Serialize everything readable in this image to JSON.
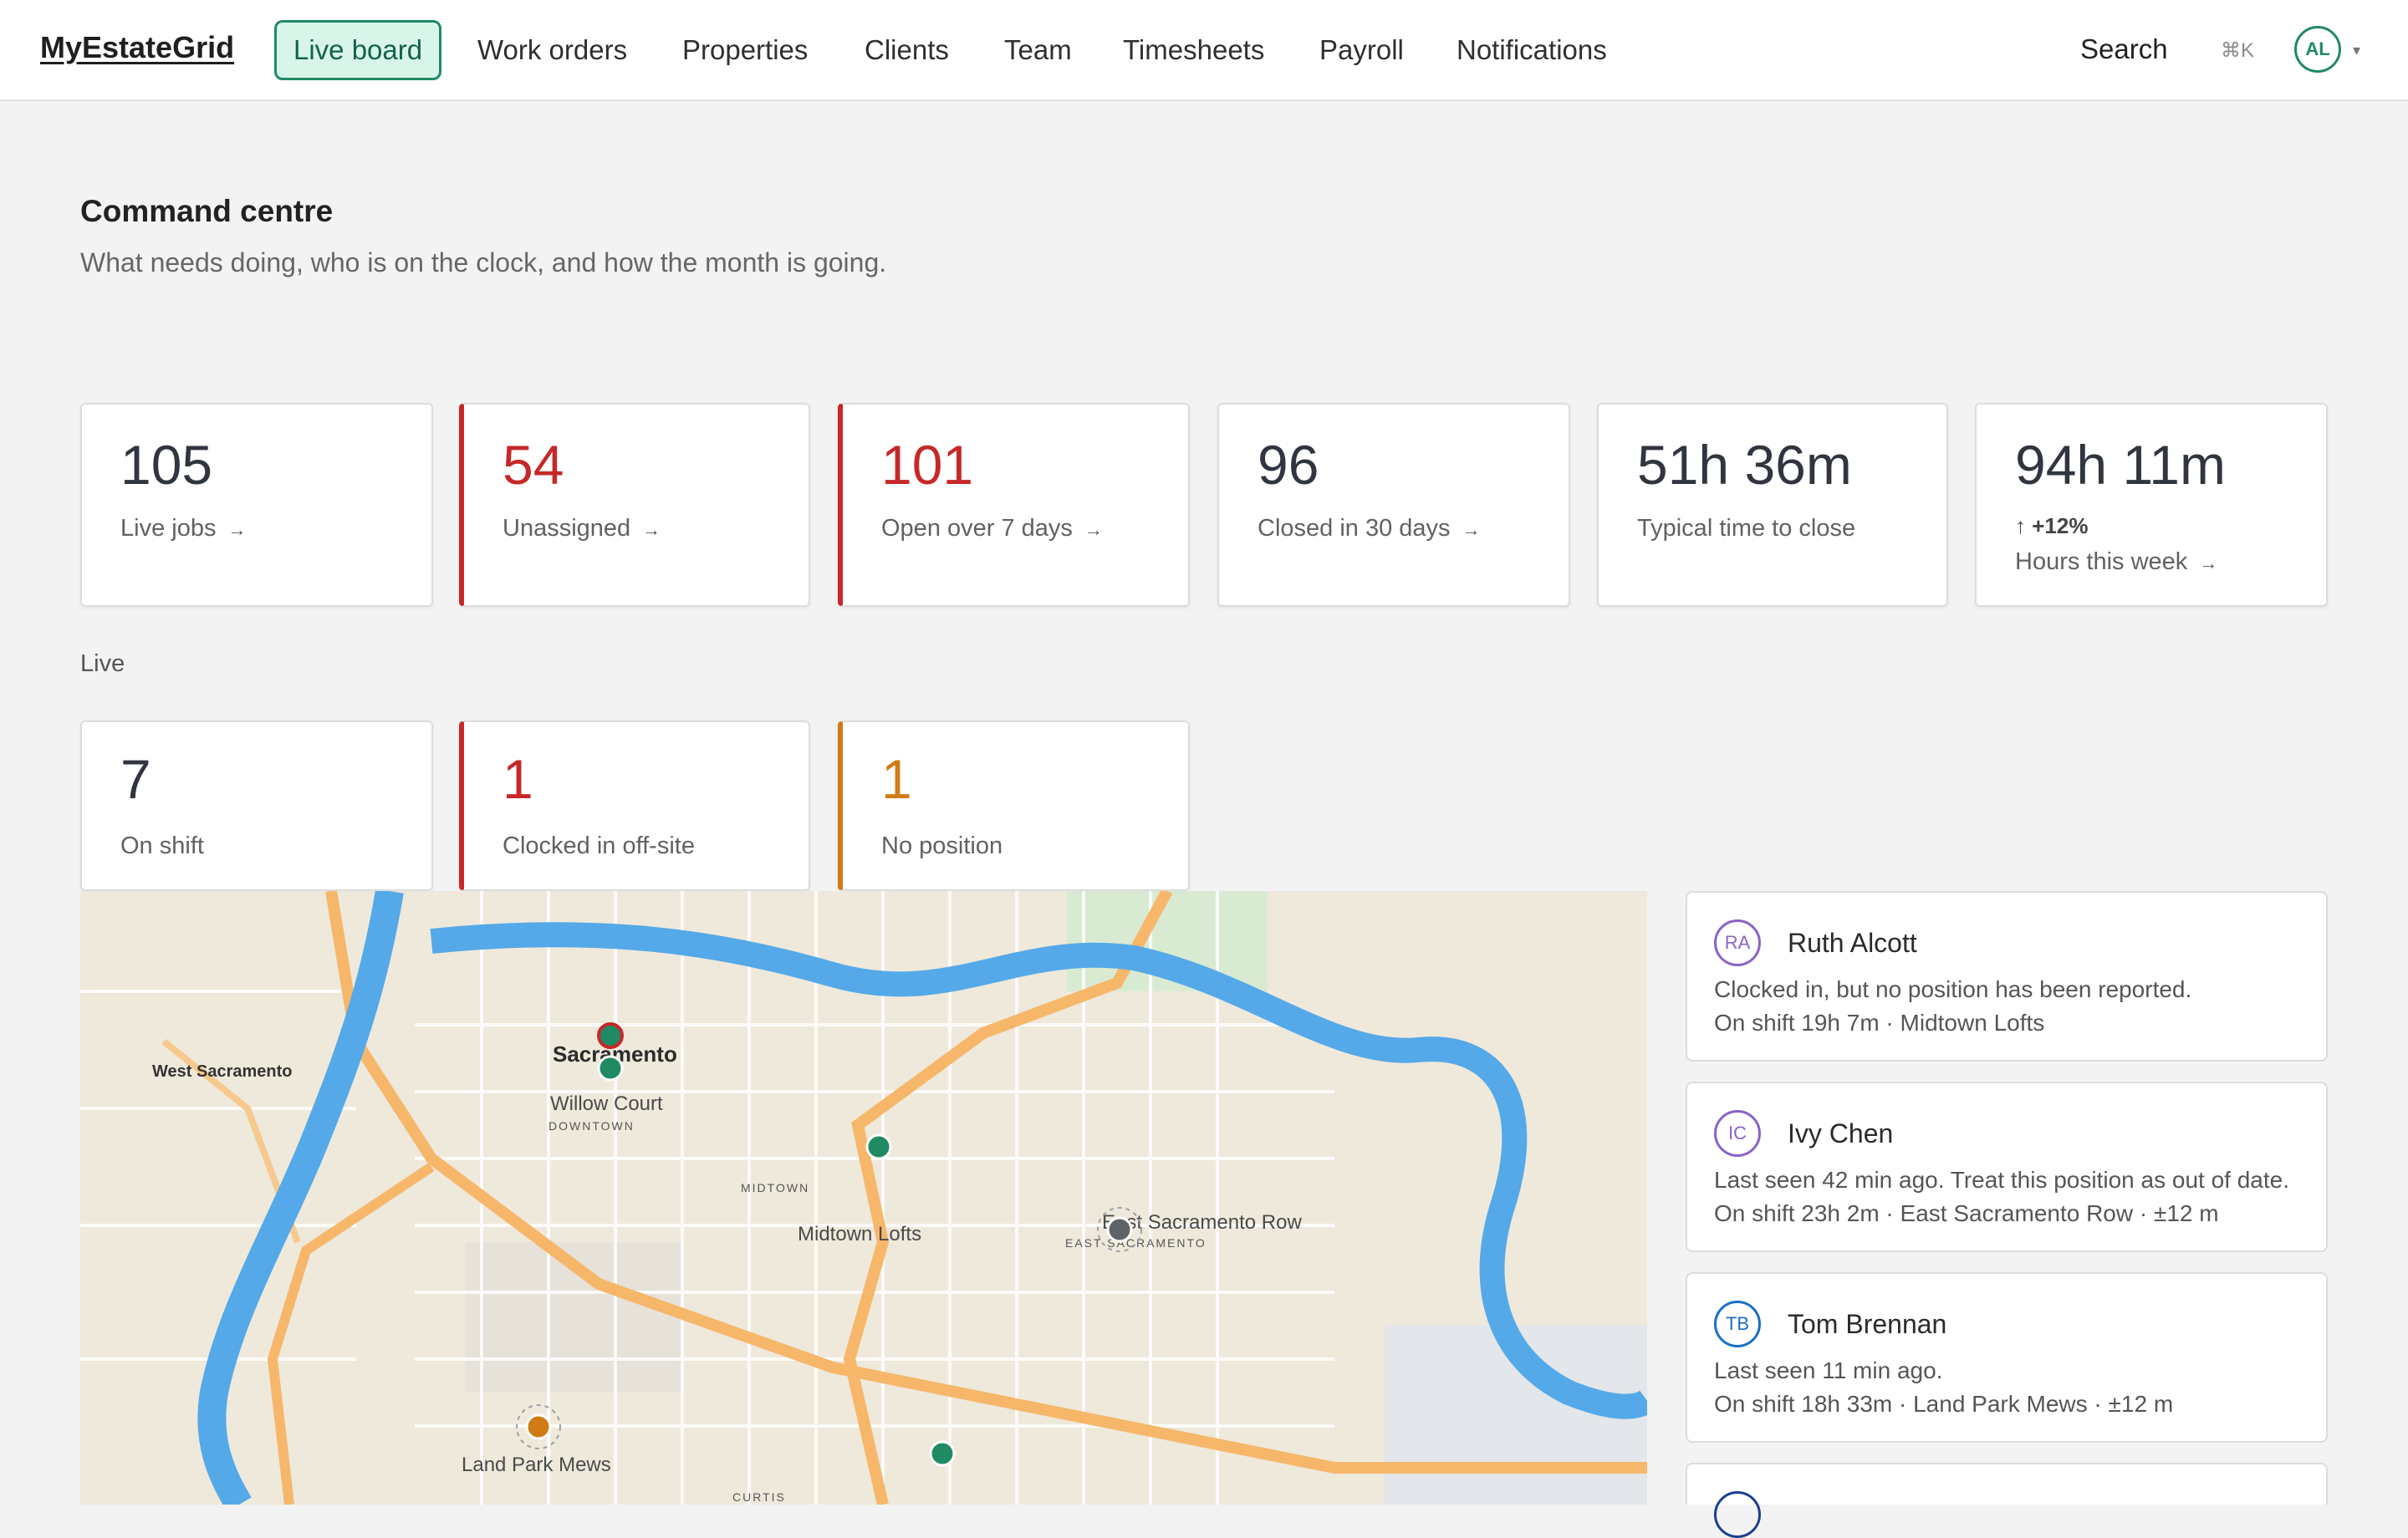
{
  "nav": {
    "brand": "MyEstateGrid",
    "items": [
      {
        "label": "Live board",
        "active": true
      },
      {
        "label": "Work orders"
      },
      {
        "label": "Properties"
      },
      {
        "label": "Clients"
      },
      {
        "label": "Team"
      },
      {
        "label": "Timesheets"
      },
      {
        "label": "Payroll"
      },
      {
        "label": "Notifications"
      }
    ],
    "search_label": "Search",
    "shortcut": "⌘K",
    "user_initials": "AL"
  },
  "header": {
    "title": "Command centre",
    "subtitle": "What needs doing, who is on the clock, and how the month is going."
  },
  "stats": [
    {
      "value": "105",
      "label": "Live jobs",
      "arrow": "→"
    },
    {
      "value": "54",
      "label": "Unassigned",
      "arrow": "→",
      "status": "alert"
    },
    {
      "value": "101",
      "label": "Open over 7 days",
      "arrow": "→",
      "status": "alert"
    },
    {
      "value": "96",
      "label": "Closed in 30 days",
      "arrow": "→"
    },
    {
      "value": "51h 36m",
      "label": "Typical time to close"
    },
    {
      "value": "94h 11m",
      "delta": "↑ +12%",
      "label": "Hours this week",
      "arrow": "→"
    }
  ],
  "live": {
    "section_label": "Live",
    "stats": [
      {
        "value": "7",
        "label": "On shift"
      },
      {
        "value": "1",
        "label": "Clocked in off-site",
        "status": "alert"
      },
      {
        "value": "1",
        "label": "No position",
        "status": "warn"
      }
    ]
  },
  "map": {
    "labels": {
      "city": "Sacramento",
      "west": "West Sacramento",
      "downtown": "DOWNTOWN",
      "midtown": "MIDTOWN",
      "east": "EAST SACRAMENTO",
      "curtis": "CURTIS"
    },
    "sites": [
      {
        "name": "Willow Court"
      },
      {
        "name": "Midtown Lofts"
      },
      {
        "name": "East Sacramento Row"
      },
      {
        "name": "Land Park Mews"
      }
    ],
    "colors": {
      "on_site": "#1f8a63",
      "off_site": "#c62828",
      "stale": "#5f6368",
      "no_position": "#d07b15"
    }
  },
  "people": [
    {
      "initials": "RA",
      "name": "Ruth Alcott",
      "status": "Clocked in, but no position has been reported.",
      "meta": "On shift 19h 7m · Midtown Lofts",
      "color": "#8a63c9"
    },
    {
      "initials": "IC",
      "name": "Ivy Chen",
      "status": "Last seen 42 min ago. Treat this position as out of date.",
      "meta": "On shift 23h 2m · East Sacramento Row · ±12 m",
      "color": "#8a63c9"
    },
    {
      "initials": "TB",
      "name": "Tom Brennan",
      "status": "Last seen 11 min ago.",
      "meta": "On shift 18h 33m · Land Park Mews · ±12 m",
      "color": "#1a6fc4"
    }
  ]
}
